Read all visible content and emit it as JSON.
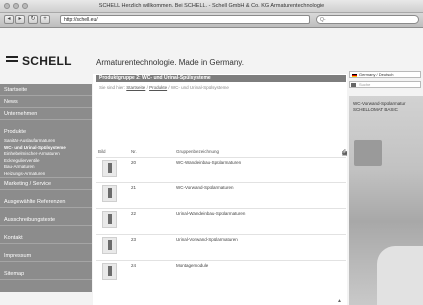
{
  "window": {
    "title": "SCHELL Herzlich willkommen. Bei SCHELL. - Schell GmbH & Co. KG Armaturentechnologie",
    "url": "http://schell.eu/",
    "search_placeholder": "Q-"
  },
  "header": {
    "logo_text": "SCHELL",
    "tagline": "Armaturentechnologie. Made in Germany."
  },
  "sidebar": {
    "items": [
      {
        "label": "Startseite"
      },
      {
        "label": "News"
      },
      {
        "label": "Unternehmen"
      },
      {
        "label": "Produkte"
      }
    ],
    "sub_items": [
      {
        "label": "Sanitär-Auslaufarmaturen"
      },
      {
        "label": "WC- und Urinal-Spülsysteme"
      },
      {
        "label": "Einhebelmischer-Armaturen"
      },
      {
        "label": "Eckregulierventile"
      },
      {
        "label": "Bau-Armaturen"
      },
      {
        "label": "Heizungs-Armaturen"
      }
    ],
    "items_after": [
      {
        "label": "Marketing / Service"
      },
      {
        "label": "Ausgewählte Referenzen"
      },
      {
        "label": "Ausschreibungstexte"
      },
      {
        "label": "Kontakt"
      },
      {
        "label": "Impressum"
      },
      {
        "label": "Sitemap"
      }
    ]
  },
  "content": {
    "heading": "Produktgruppe 2: WC- und Urinal-Spülsysteme",
    "breadcrumb_prefix": "Sie sind hier:",
    "breadcrumb_link1": "Startseite",
    "breadcrumb_link2": "Produkte",
    "breadcrumb_tail": "/ WC- und Urinal-Spülsysteme",
    "table_headers": {
      "image": "Bild",
      "nr": "Nr.",
      "name": "Gruppenbezeichnung"
    },
    "rows": [
      {
        "nr": "20",
        "name": "WC-Wandeinbau-Spülarmaturen"
      },
      {
        "nr": "21",
        "name": "WC-Vorwand-Spülarmaturen"
      },
      {
        "nr": "22",
        "name": "Urinal-Wandeinbau-Spülarmaturen"
      },
      {
        "nr": "23",
        "name": "Urinal-Vorwand-Spülarmaturen"
      },
      {
        "nr": "24",
        "name": "Montagemodule"
      }
    ]
  },
  "right": {
    "language": "Germany / Deutsch",
    "search_placeholder": "Suche",
    "promo_text": "WC-Vorwand-Spülarmatur SCHELLOMAT BASIC"
  }
}
